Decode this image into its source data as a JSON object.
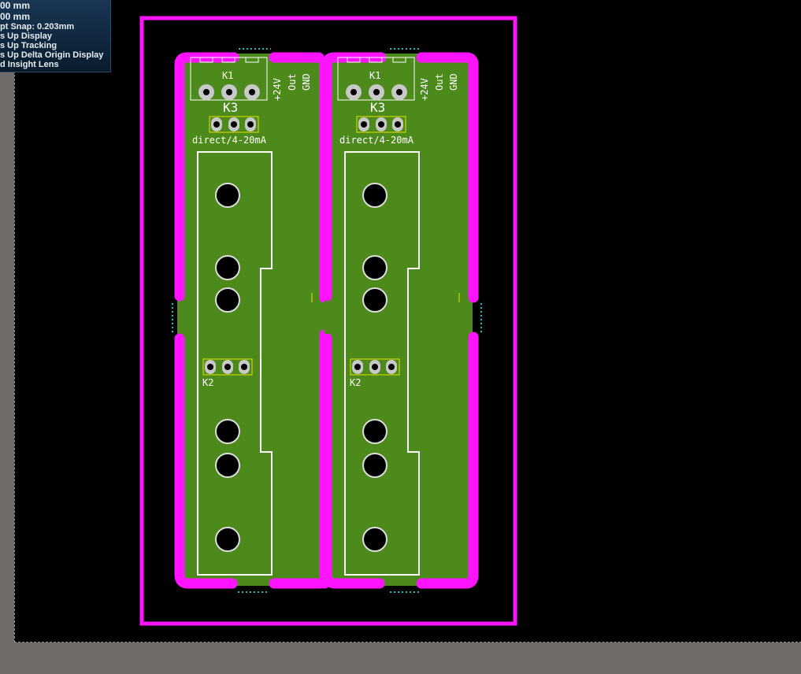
{
  "hud": {
    "x_readout": "00 mm",
    "y_readout": "00 mm",
    "snap": "pt Snap: 0.203mm",
    "heads_up_display": "s Up Display",
    "heads_up_tracking": "s Up Tracking",
    "heads_up_delta": "s Up Delta Origin Display",
    "insight_lens": "d Insight Lens"
  },
  "colors": {
    "board": "#4d8a1c",
    "board_outline": "#ff14ff",
    "silkscreen": "#ffffff",
    "pad": "#c8c8c8",
    "pad_outline": "#e8e000",
    "hole": "#000000",
    "workspace": "#000000",
    "background": "#706c6a",
    "hud_text": "#e6eef5",
    "rule_marker": "#26b8b8"
  },
  "boards": [
    {
      "k1_label": "K1",
      "k3_label": "K3",
      "k2_label": "K2",
      "voltage_label": "+24V",
      "out_label": "Out",
      "gnd_label": "GND",
      "mode_label": "direct/4-20mA"
    },
    {
      "k1_label": "K1",
      "k3_label": "K3",
      "k2_label": "K2",
      "voltage_label": "+24V",
      "out_label": "Out",
      "gnd_label": "GND",
      "mode_label": "direct/4-20mA"
    }
  ]
}
